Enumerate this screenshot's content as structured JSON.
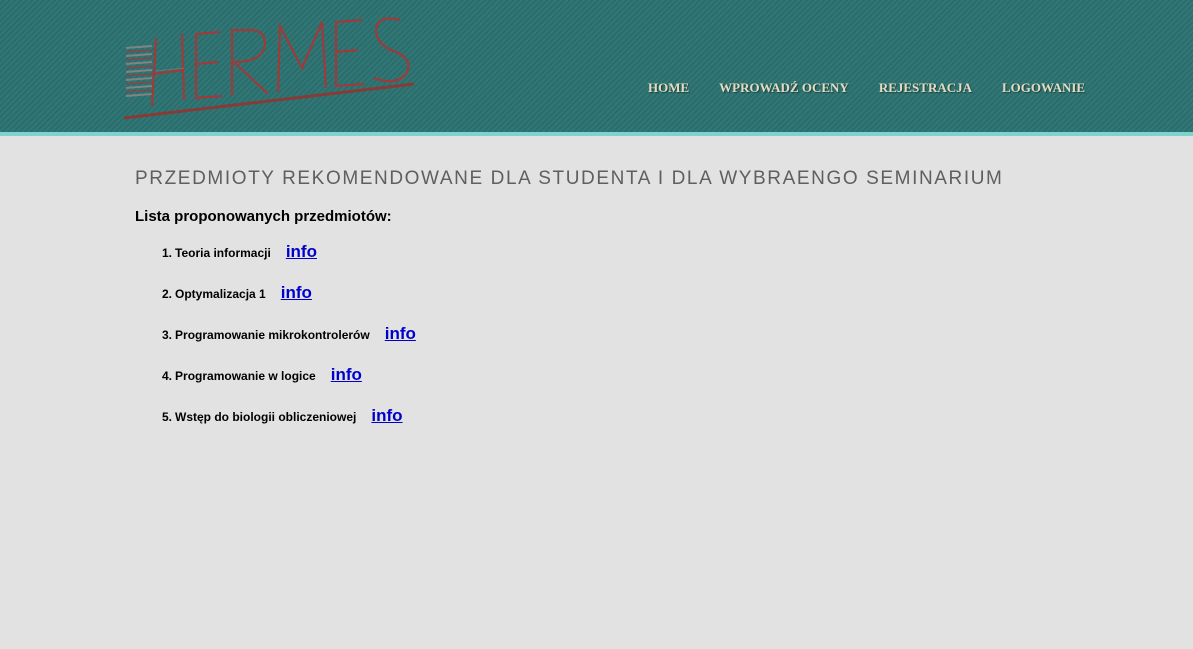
{
  "header": {
    "logo_text": "HERMES",
    "nav": [
      {
        "label": "HOME"
      },
      {
        "label": "WPROWADŹ OCENY"
      },
      {
        "label": "REJESTRACJA"
      },
      {
        "label": "LOGOWANIE"
      }
    ]
  },
  "main": {
    "title": "PRZEDMIOTY REKOMENDOWANE DLA STUDENTA I DLA WYBRAENGO SEMINARIUM",
    "subtitle": "Lista proponowanych przedmiotów:",
    "subjects": [
      {
        "number": "1.",
        "name": "Teoria informacji",
        "link": "info"
      },
      {
        "number": "2.",
        "name": "Optymalizacja 1",
        "link": "info"
      },
      {
        "number": "3.",
        "name": "Programowanie mikrokontrolerów",
        "link": "info"
      },
      {
        "number": "4.",
        "name": "Programowanie w logice",
        "link": "info"
      },
      {
        "number": "5.",
        "name": "Wstęp do biologii obliczeniowej",
        "link": "info"
      }
    ]
  },
  "colors": {
    "header_bg": "#2a7270",
    "header_border": "#7fd3cf",
    "page_bg": "#e2e2e2",
    "nav_text": "#e3dcc2",
    "logo_red": "#a03a3a",
    "link": "#0000cc"
  }
}
